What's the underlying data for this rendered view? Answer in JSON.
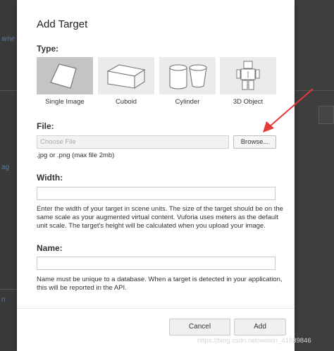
{
  "background": {
    "left_text_1": "ame",
    "left_text_2": "ag",
    "left_text_3": "n"
  },
  "dialog": {
    "title": "Add Target",
    "type_label": "Type:",
    "types": [
      {
        "label": "Single Image",
        "icon": "single-image-icon",
        "selected": true
      },
      {
        "label": "Cuboid",
        "icon": "cuboid-icon",
        "selected": false
      },
      {
        "label": "Cylinder",
        "icon": "cylinder-icon",
        "selected": false
      },
      {
        "label": "3D Object",
        "icon": "3d-object-icon",
        "selected": false
      }
    ],
    "file": {
      "label": "File:",
      "placeholder": "Choose File",
      "browse_label": "Browse...",
      "hint": ".jpg or .png (max file 2mb)"
    },
    "width": {
      "label": "Width:",
      "value": "",
      "help": "Enter the width of your target in scene units. The size of the target should be on the same scale as your augmented virtual content. Vuforia uses meters as the default unit scale. The target's height will be calculated when you upload your image."
    },
    "name": {
      "label": "Name:",
      "value": "",
      "help": "Name must be unique to a database. When a target is detected in your application, this will be reported in the API."
    },
    "buttons": {
      "cancel": "Cancel",
      "add": "Add"
    }
  },
  "watermark": "https://blog.csdn.net/weixin_41839846",
  "colors": {
    "selected_tile": "#c4c4c4",
    "tile": "#ebebeb",
    "annotation_arrow": "#e53935"
  }
}
